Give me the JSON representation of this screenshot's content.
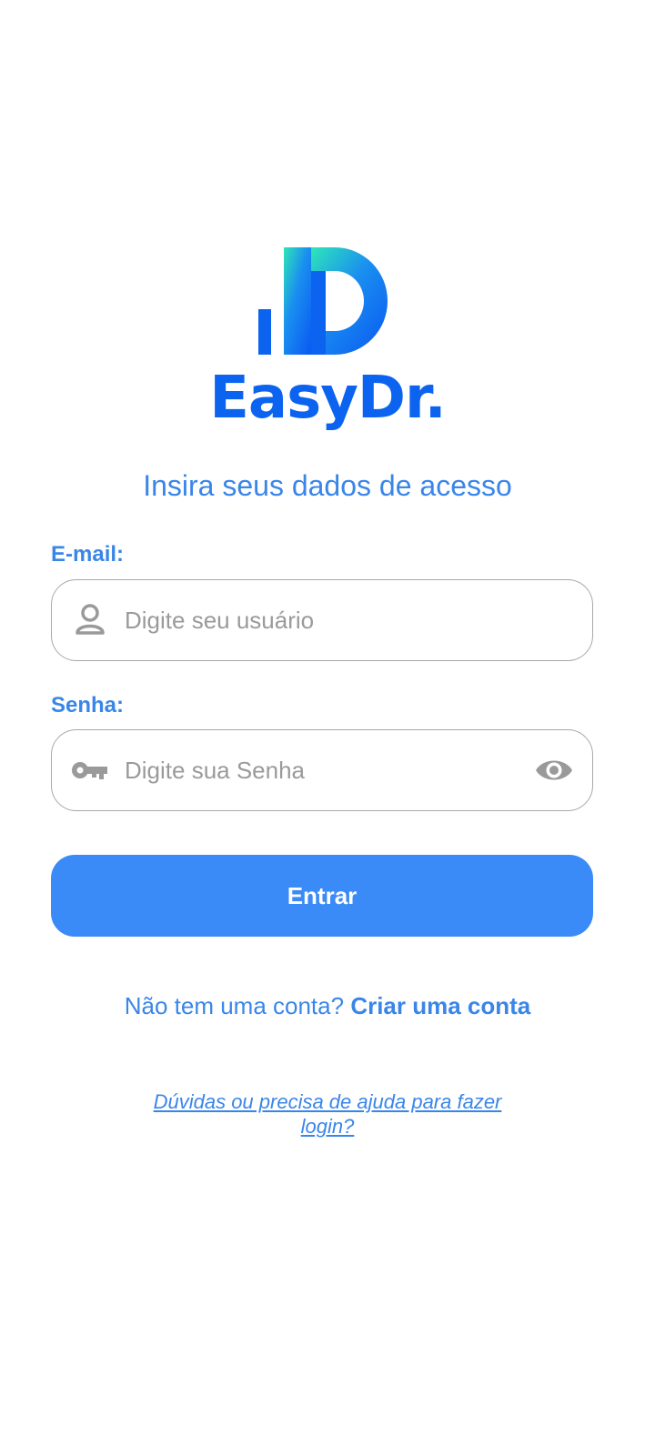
{
  "brand": {
    "name": "EasyDr.",
    "primary_color": "#0b63f0",
    "gradient_color": "#2ee6b8"
  },
  "header": {
    "subtitle": "Insira seus dados de acesso"
  },
  "form": {
    "email": {
      "label": "E-mail:",
      "placeholder": "Digite seu usuário",
      "value": "",
      "icon": "person-icon"
    },
    "password": {
      "label": "Senha:",
      "placeholder": "Digite sua Senha",
      "value": "",
      "icon": "key-icon",
      "toggle_icon": "eye-icon"
    },
    "submit_label": "Entrar",
    "button_color": "#3a8af7"
  },
  "signup": {
    "prompt": "Não tem uma conta?",
    "link": "Criar uma conta"
  },
  "help": {
    "link": "Dúvidas ou precisa de ajuda para fazer login?"
  }
}
